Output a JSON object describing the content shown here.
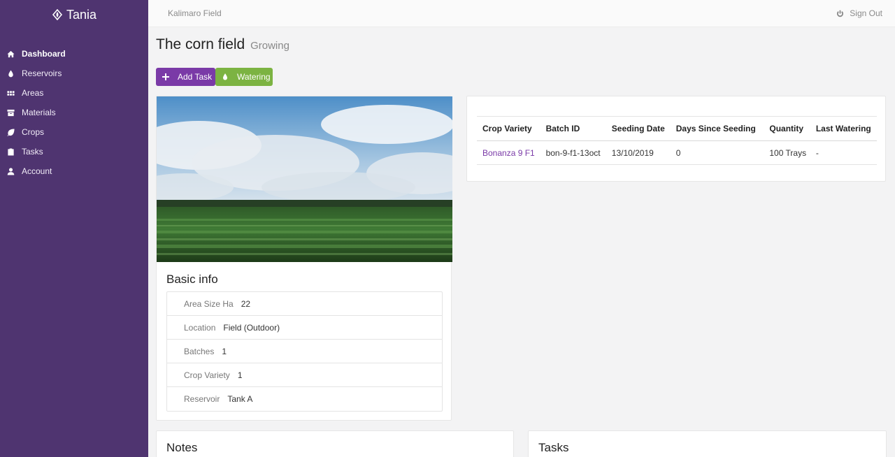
{
  "app": {
    "name": "Tania"
  },
  "sidebar": {
    "items": [
      {
        "label": "Dashboard",
        "icon": "home-icon"
      },
      {
        "label": "Reservoirs",
        "icon": "drop-icon"
      },
      {
        "label": "Areas",
        "icon": "grid-icon"
      },
      {
        "label": "Materials",
        "icon": "archive-icon"
      },
      {
        "label": "Crops",
        "icon": "leaf-icon"
      },
      {
        "label": "Tasks",
        "icon": "clipboard-icon"
      },
      {
        "label": "Account",
        "icon": "user-icon"
      }
    ]
  },
  "header": {
    "breadcrumb": "Kalimaro Field",
    "signout": "Sign Out"
  },
  "page": {
    "title": "The corn field",
    "status": "Growing"
  },
  "actions": {
    "add_task": "Add Task",
    "watering": "Watering"
  },
  "colors": {
    "sidebar": "#4f3470",
    "primary": "#7a3aa7",
    "success": "#7cb342"
  },
  "basic_info": {
    "title": "Basic info",
    "rows": [
      {
        "label": "Area Size Ha",
        "value": "22"
      },
      {
        "label": "Location",
        "value": "Field (Outdoor)"
      },
      {
        "label": "Batches",
        "value": "1"
      },
      {
        "label": "Crop Variety",
        "value": "1"
      },
      {
        "label": "Reservoir",
        "value": "Tank A"
      }
    ]
  },
  "crops_table": {
    "headers": [
      "Crop Variety",
      "Batch ID",
      "Seeding Date",
      "Days Since Seeding",
      "Quantity",
      "Last Watering"
    ],
    "rows": [
      [
        "Bonanza 9 F1",
        "bon-9-f1-13oct",
        "13/10/2019",
        "0",
        "100 Trays",
        "-"
      ]
    ]
  },
  "notes": {
    "title": "Notes"
  },
  "tasks": {
    "title": "Tasks"
  }
}
